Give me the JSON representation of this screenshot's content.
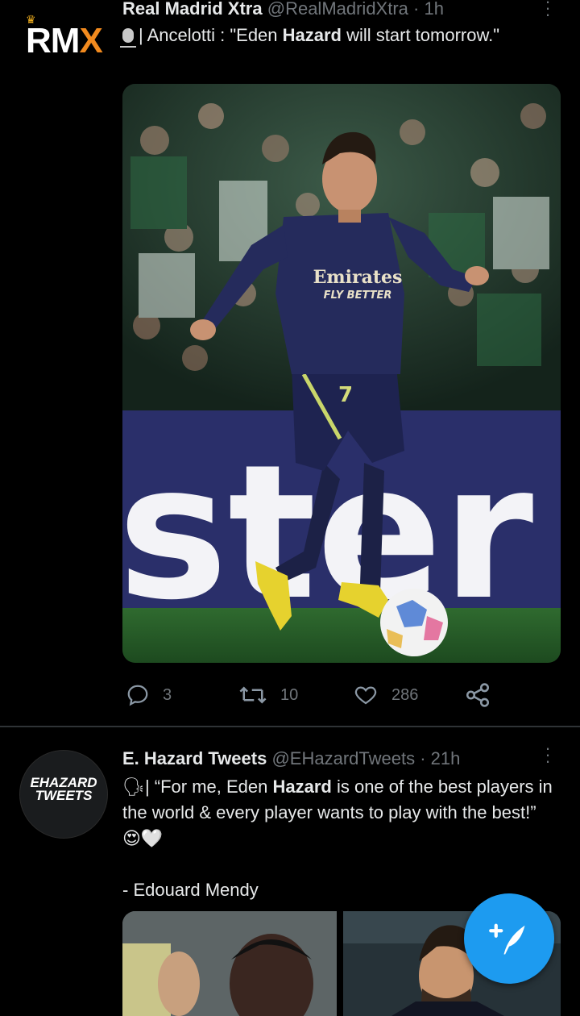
{
  "tweets": [
    {
      "author_name": "Real Madrid Xtra",
      "handle": "@RealMadridXtra",
      "time": "1h",
      "avatar_text": "RM",
      "avatar_text_x": "X",
      "text_before": "| Ancelotti : \"Eden ",
      "text_bold": "Hazard",
      "text_after": " will start tomorrow.\"",
      "replies": "3",
      "retweets": "10",
      "likes": "286",
      "media_text": "ster",
      "shirt_text_1": "Emirates",
      "shirt_text_2": "FLY BETTER",
      "shirt_number": "7"
    },
    {
      "author_name": "E. Hazard Tweets",
      "handle": "@EHazardTweets",
      "time": "21h",
      "avatar_line1": "EHAZARD",
      "avatar_line2": "TWEETS",
      "text_before": "| “For me, Eden ",
      "text_bold": "Hazard",
      "text_after": " is one of the best players in the world & every player wants to play with the best!” ",
      "emoji": "😍🤍",
      "signature": "- Edouard Mendy"
    }
  ],
  "colors": {
    "background": "#000000",
    "text": "#e7e9ea",
    "secondary": "#71767b",
    "accent": "#1d9bf0",
    "brand_orange": "#f28a1e"
  },
  "icons": {
    "reply": "reply-icon",
    "retweet": "retweet-icon",
    "like": "heart-icon",
    "share": "share-icon",
    "compose": "compose-feather-icon"
  }
}
